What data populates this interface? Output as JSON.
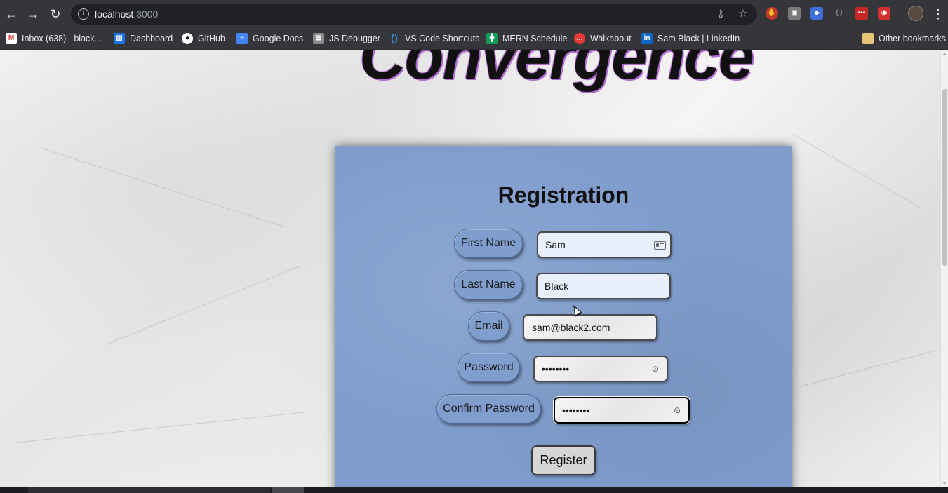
{
  "browser": {
    "url_host": "localhost",
    "url_port": ":3000",
    "nav": {
      "back_icon": "arrow-left-icon",
      "forward_icon": "arrow-right-icon",
      "reload_icon": "reload-icon"
    },
    "bookmarks": [
      {
        "label": "Inbox (638) - black...",
        "icon": "gmail-icon",
        "color": "#d93025"
      },
      {
        "label": "Dashboard",
        "icon": "trello-icon",
        "color": "#1a73e8"
      },
      {
        "label": "GitHub",
        "icon": "github-icon",
        "color": "#ffffff"
      },
      {
        "label": "Google Docs",
        "icon": "docs-icon",
        "color": "#4285f4"
      },
      {
        "label": "JS Debugger",
        "icon": "debugger-icon",
        "color": "#8a8a8a"
      },
      {
        "label": "VS Code Shortcuts",
        "icon": "vscode-icon",
        "color": "#3b8eea"
      },
      {
        "label": "MERN Schedule",
        "icon": "sheet-icon",
        "color": "#0f9d58"
      },
      {
        "label": "Walkabout",
        "icon": "chat-icon",
        "color": "#e53935"
      },
      {
        "label": "Sam Black | LinkedIn",
        "icon": "linkedin-icon",
        "color": "#0a66c2"
      }
    ],
    "other_bookmarks": "Other bookmarks"
  },
  "page": {
    "logo_text": "Convergence",
    "form": {
      "title": "Registration",
      "fields": [
        {
          "label": "First Name",
          "value": "Sam"
        },
        {
          "label": "Last Name",
          "value": "Black"
        },
        {
          "label": "Email",
          "value": "sam@black2.com"
        },
        {
          "label": "Password",
          "value": "••••••••"
        },
        {
          "label": "Confirm Password",
          "value": "••••••••"
        }
      ],
      "submit_label": "Register"
    }
  },
  "colors": {
    "card": "#7f9dcd",
    "autofill": "#e8f0fe",
    "chrome": "#35363a"
  }
}
